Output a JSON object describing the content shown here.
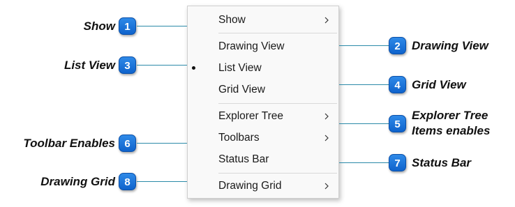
{
  "menu": {
    "items": [
      {
        "label": "Show",
        "submenu": true
      },
      {
        "label": "Drawing View",
        "submenu": false
      },
      {
        "label": "List View",
        "submenu": false,
        "selected": true
      },
      {
        "label": "Grid View",
        "submenu": false
      },
      {
        "label": "Explorer Tree",
        "submenu": true
      },
      {
        "label": "Toolbars",
        "submenu": true
      },
      {
        "label": "Status Bar",
        "submenu": false
      },
      {
        "label": "Drawing Grid",
        "submenu": true
      }
    ]
  },
  "callouts": [
    {
      "number": "1",
      "text": "Show"
    },
    {
      "number": "2",
      "text": "Drawing View"
    },
    {
      "number": "3",
      "text": "List View"
    },
    {
      "number": "4",
      "text": "Grid View"
    },
    {
      "number": "5",
      "text_line1": "Explorer Tree",
      "text_line2": "Items enables"
    },
    {
      "number": "6",
      "text": "Toolbar Enables"
    },
    {
      "number": "7",
      "text": "Status Bar"
    },
    {
      "number": "8",
      "text": "Drawing Grid"
    }
  ],
  "colors": {
    "badge": "#1a74d9",
    "connector": "#2b8aa8"
  }
}
